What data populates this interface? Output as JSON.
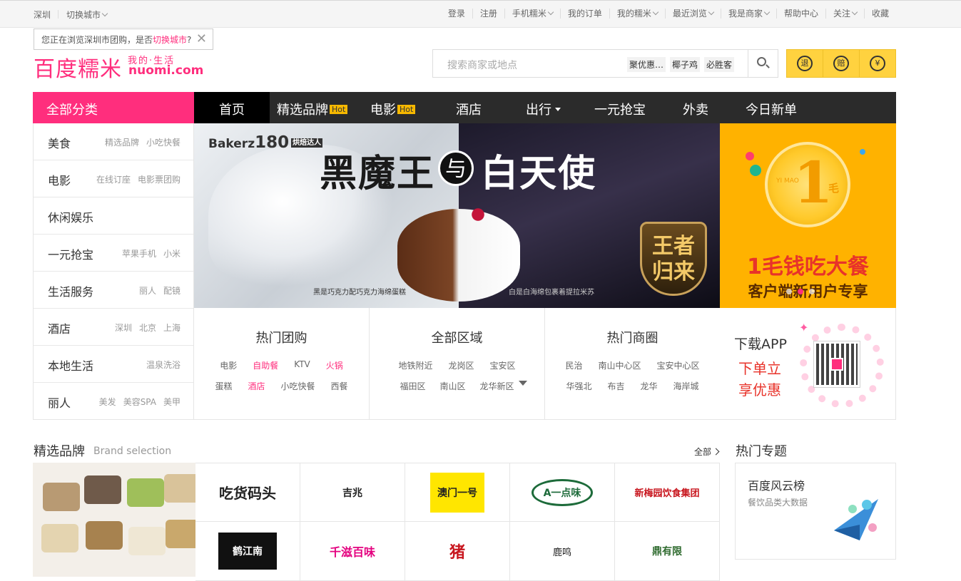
{
  "topbar": {
    "city": "深圳",
    "switch_city": "切换城市",
    "links": [
      "登录",
      "注册",
      "手机糯米",
      "我的订单",
      "我的糯米",
      "最近浏览",
      "我是商家",
      "帮助中心",
      "关注",
      "收藏"
    ]
  },
  "city_tip": {
    "text": "您正在浏览深圳市团购，是否",
    "link": "切换城市",
    "suffix": "?"
  },
  "logo": {
    "cn": "百度糯米",
    "sub": "我的·生活",
    "en": "nuomi.com"
  },
  "search": {
    "placeholder": "搜索商家或地点",
    "hot_words": [
      "聚优惠…",
      "椰子鸡",
      "必胜客"
    ]
  },
  "guarantee": [
    "退",
    "赔",
    "¥"
  ],
  "nav": {
    "all_categories": "全部分类",
    "items": [
      {
        "label": "首页",
        "badge": ""
      },
      {
        "label": "精选品牌",
        "badge": "Hot"
      },
      {
        "label": "电影",
        "badge": "Hot"
      },
      {
        "label": "酒店",
        "badge": ""
      },
      {
        "label": "出行",
        "badge": ""
      },
      {
        "label": "一元抢宝",
        "badge": ""
      },
      {
        "label": "外卖",
        "badge": ""
      },
      {
        "label": "今日新单",
        "badge": ""
      }
    ]
  },
  "categories": [
    {
      "name": "美食",
      "subs": [
        "精选品牌",
        "小吃快餐"
      ]
    },
    {
      "name": "电影",
      "subs": [
        "在线订座",
        "电影票团购"
      ]
    },
    {
      "name": "休闲娱乐",
      "subs": []
    },
    {
      "name": "一元抢宝",
      "subs": [
        "苹果手机",
        "小米"
      ]
    },
    {
      "name": "生活服务",
      "subs": [
        "丽人",
        "配镜"
      ]
    },
    {
      "name": "酒店",
      "subs": [
        "深圳",
        "北京",
        "上海"
      ]
    },
    {
      "name": "本地生活",
      "subs": [
        "温泉洗浴"
      ]
    },
    {
      "name": "丽人",
      "subs": [
        "美发",
        "美容SPA",
        "美甲"
      ]
    }
  ],
  "banner": {
    "brand": "Bakerz",
    "brand_num": "180",
    "brand_tag": "烘焙达人",
    "title_left": "黑魔王",
    "title_mid": "与",
    "title_right": "白天使",
    "badge_line1": "王者",
    "badge_line2": "归来",
    "caption_left": "黑是巧克力配巧克力海绵蛋糕",
    "caption_right": "白是白海绵包裹着提拉米苏"
  },
  "promo": {
    "coin_num": "1",
    "coin_unit": "毛",
    "coin_pinyin": "YI MAO",
    "line1": "1毛钱吃大餐",
    "line2": "客户端新用户专享"
  },
  "panels": [
    {
      "title": "热门团购",
      "rows": [
        [
          "电影",
          "自助餐",
          "KTV",
          "火锅"
        ],
        [
          "蛋糕",
          "酒店",
          "小吃快餐",
          "西餐"
        ]
      ],
      "highlight": [
        "自助餐",
        "火锅",
        "酒店"
      ]
    },
    {
      "title": "全部区域",
      "rows": [
        [
          "地铁附近",
          "龙岗区",
          "宝安区"
        ],
        [
          "福田区",
          "南山区",
          "龙华新区"
        ]
      ],
      "highlight": []
    },
    {
      "title": "热门商圈",
      "rows": [
        [
          "民治",
          "南山中心区",
          "宝安中心区"
        ],
        [
          "华强北",
          "布吉",
          "龙华",
          "海岸城"
        ]
      ],
      "highlight": []
    }
  ],
  "app": {
    "download": "下载APP",
    "line1": "下单立",
    "line2": "享优惠"
  },
  "brands": {
    "title": "精选品牌",
    "title_en": "Brand selection",
    "all": "全部",
    "logos": [
      "吃货码头",
      "吉兆",
      "澳门一号",
      "A一点味",
      "新梅园饮食集团",
      "鹤江南",
      "千滋百味",
      "猪",
      "鹿鸣",
      "鼎有限"
    ]
  },
  "hot_topics": {
    "title": "热门专题",
    "card_title": "百度风云榜",
    "card_sub": "餐饮品类大数据"
  }
}
